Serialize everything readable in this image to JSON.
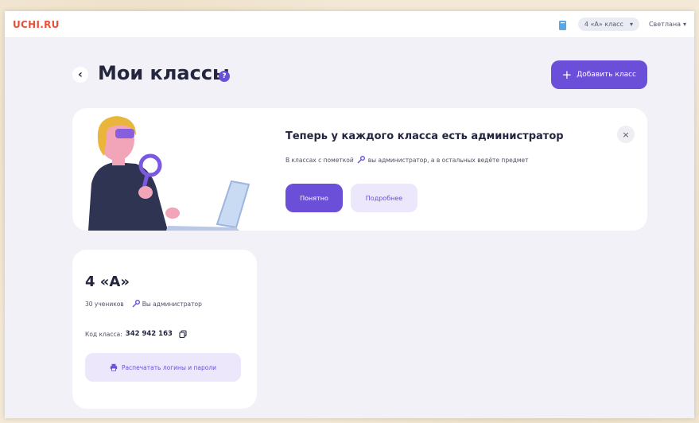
{
  "topbar": {
    "logo": "UCHI.RU",
    "book_icon": "book-icon",
    "class_selector": "4 «А» класс",
    "user_name": "Светлана"
  },
  "page": {
    "title": "Мои классы",
    "help_symbol": "?",
    "add_class_label": "Добавить класс"
  },
  "banner": {
    "title": "Теперь у каждого класса есть администратор",
    "text_before_icon": "В классах с пометкой",
    "text_after_icon": "вы администратор, а в остальных ведёте предмет",
    "ok_label": "Понятно",
    "more_label": "Подробнее",
    "close_symbol": "×"
  },
  "class_card": {
    "name": "4 «А»",
    "students": "30 учеников",
    "admin_label": "Вы администратор",
    "code_label": "Код класса:",
    "code_value": "342 942 163",
    "print_label": "Распечатать логины и пароли"
  },
  "colors": {
    "accent": "#6b4fd8",
    "accent_light": "#ece7fb",
    "logo": "#e8503a",
    "background": "#f2f1f7"
  }
}
